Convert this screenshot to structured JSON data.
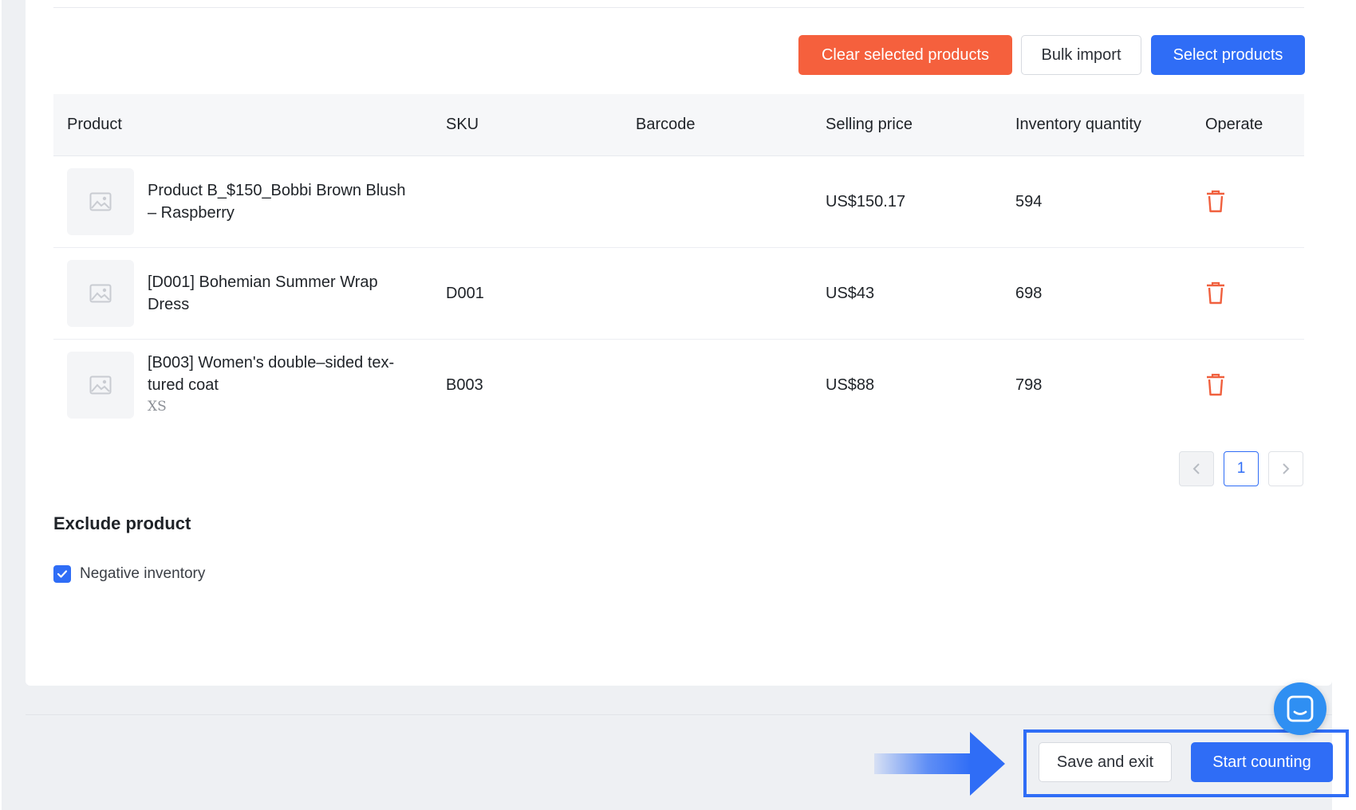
{
  "toolbar": {
    "clear_label": "Clear selected products",
    "bulk_import_label": "Bulk import",
    "select_label": "Select products"
  },
  "table": {
    "columns": [
      "Product",
      "SKU",
      "Barcode",
      "Selling price",
      "Inventory quantity",
      "Operate"
    ],
    "rows": [
      {
        "name": "Product B_$150_Bobbi Brown Blush – Raspberry",
        "variant": "",
        "sku": "",
        "barcode": "",
        "price": "US$150.17",
        "quantity": "594",
        "thumbnail_icon": "image-placeholder-icon",
        "action_icon": "trash-icon"
      },
      {
        "name": "[D001] Bohemian Summer Wrap Dress",
        "variant": "",
        "sku": "D001",
        "barcode": "",
        "price": "US$43",
        "quantity": "698",
        "thumbnail_icon": "image-placeholder-icon",
        "action_icon": "trash-icon"
      },
      {
        "name": "[B003] Women's double–sided tex-tured coat",
        "variant": "XS",
        "sku": "B003",
        "barcode": "",
        "price": "US$88",
        "quantity": "798",
        "thumbnail_icon": "image-placeholder-icon",
        "action_icon": "trash-icon"
      }
    ]
  },
  "pagination": {
    "current_page": "1",
    "prev_icon": "chevron-left-icon",
    "next_icon": "chevron-right-icon"
  },
  "exclude": {
    "title": "Exclude product",
    "negative_inventory_label": "Negative inventory",
    "negative_inventory_checked": true
  },
  "footer": {
    "save_exit_label": "Save and exit",
    "start_counting_label": "Start counting",
    "chat_icon": "chat-icon",
    "pointer_icon": "arrow-right-icon"
  },
  "colors": {
    "primary": "#2f6df6",
    "danger": "#f5603d",
    "chat": "#2f8ff2",
    "trash": "#f0603e"
  }
}
